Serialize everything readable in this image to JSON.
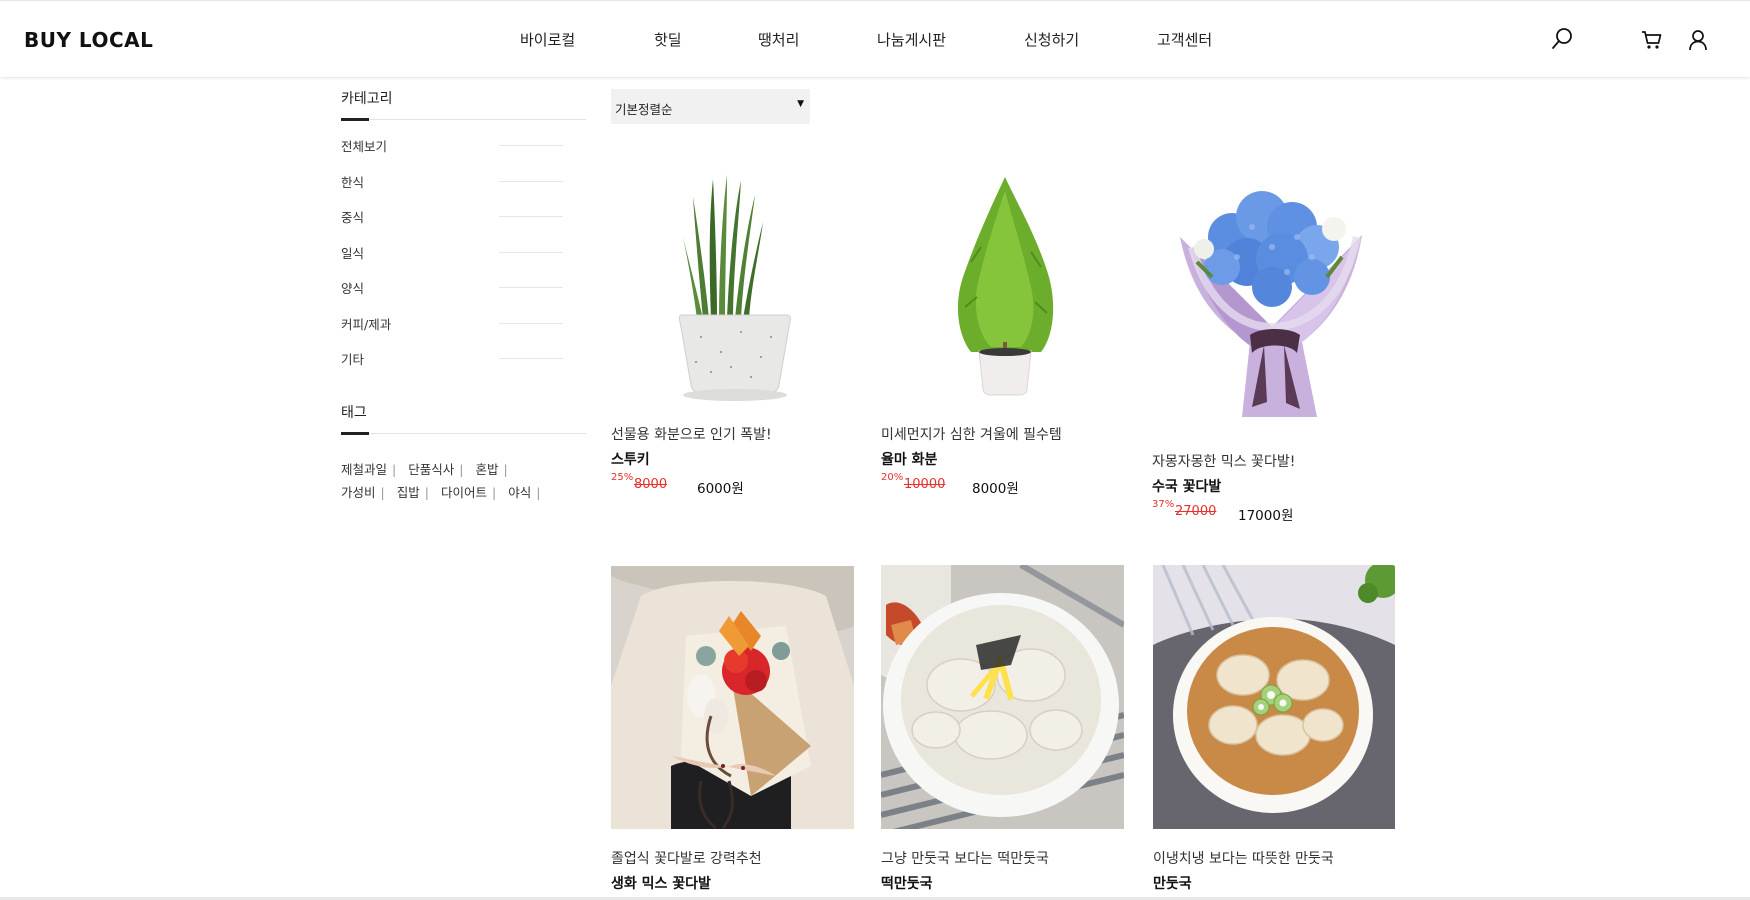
{
  "brand": "BUY LOCAL",
  "nav": [
    "바이로컬",
    "핫딜",
    "땡처리",
    "나눔게시판",
    "신청하기",
    "고객센터"
  ],
  "header_icons": [
    "search-icon",
    "cart-icon",
    "user-icon"
  ],
  "sidebar": {
    "category_title": "카테고리",
    "categories": [
      "전체보기",
      "한식",
      "중식",
      "일식",
      "양식",
      "커피/제과",
      "기타"
    ],
    "tag_title": "태그",
    "tags_row1": [
      "제철과일",
      "단품식사",
      "혼밥"
    ],
    "tags_row2": [
      "가성비",
      "집밥",
      "다이어트",
      "야식"
    ],
    "tag_separator": "|"
  },
  "sort": {
    "selected": "기본정렬순",
    "caret": "▼"
  },
  "products": [
    {
      "subtitle": "선물용 화분으로 인기 폭발!",
      "name": "스투키",
      "rate": "25%",
      "original": "8000",
      "sale": "6000원",
      "image": "potted-plant-stucky"
    },
    {
      "subtitle": "미세먼지가 심한 겨울에 필수템",
      "name": "율마 화분",
      "rate": "20%",
      "original": "10000",
      "sale": "8000원",
      "image": "potted-plant-goldcrest"
    },
    {
      "subtitle": "자몽자몽한 믹스 꽃다발!",
      "name": "수국 꽃다발",
      "rate": "37%",
      "original": "27000",
      "sale": "17000원",
      "image": "hydrangea-bouquet"
    },
    {
      "subtitle": "졸업식 꽃다발로 강력추천",
      "name": "생화 믹스 꽃다발",
      "image": "mixed-flower-bouquet"
    },
    {
      "subtitle": "그냥 만둣국 보다는 떡만둣국",
      "name": "떡만둣국",
      "image": "rice-cake-dumpling-soup"
    },
    {
      "subtitle": "이냉치냉 보다는 따뜻한 만둣국",
      "name": "만둣국",
      "image": "dumpling-soup"
    }
  ],
  "colors": {
    "discount": "#e5322d",
    "text": "#222222",
    "sort_bg": "#f1f1f1"
  }
}
